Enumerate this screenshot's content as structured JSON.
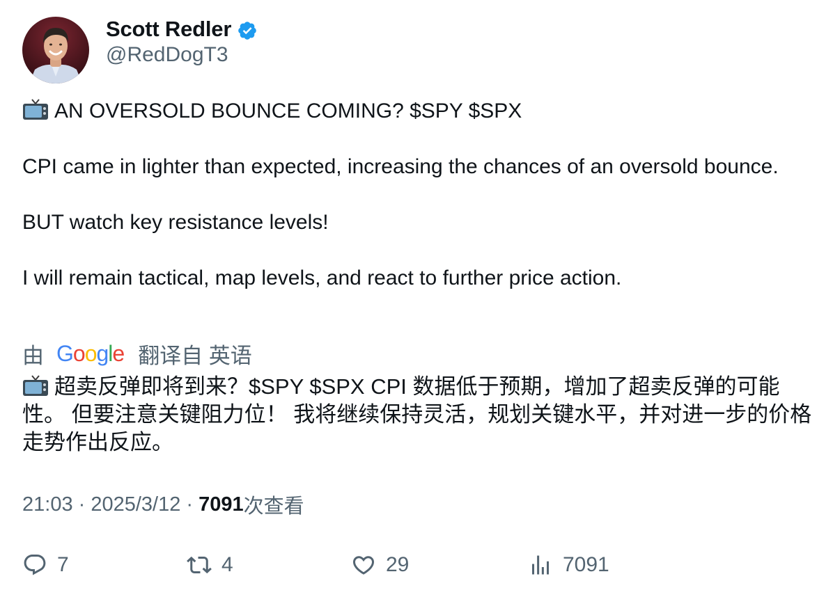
{
  "author": {
    "display_name": "Scott Redler",
    "handle": "@RedDogT3",
    "verified": true
  },
  "tweet": {
    "line1_icon": "tv-emoji-icon",
    "line1": "AN OVERSOLD BOUNCE COMING? $SPY $SPX",
    "line2": "CPI came in lighter than expected, increasing the chances of an oversold bounce.",
    "line3": "BUT watch key resistance levels!",
    "line4": "I will remain tactical, map levels, and react to further price action."
  },
  "translation": {
    "prefix": "由",
    "provider": "Google",
    "suffix": "翻译自 英语",
    "text": "超卖反弹即将到来？$SPY $SPX CPI 数据低于预期，增加了超卖反弹的可能性。 但要注意关键阻力位！ 我将继续保持灵活，规划关键水平，并对进一步的价格走势作出反应。"
  },
  "meta": {
    "time": "21:03",
    "separator": " · ",
    "date": "2025/3/12",
    "views_count": "7091",
    "views_label": "次查看"
  },
  "actions": {
    "replies": "7",
    "retweets": "4",
    "likes": "29",
    "views": "7091"
  },
  "colors": {
    "text_primary": "#0f1419",
    "text_secondary": "#536471",
    "verified_blue": "#1d9bf0"
  }
}
